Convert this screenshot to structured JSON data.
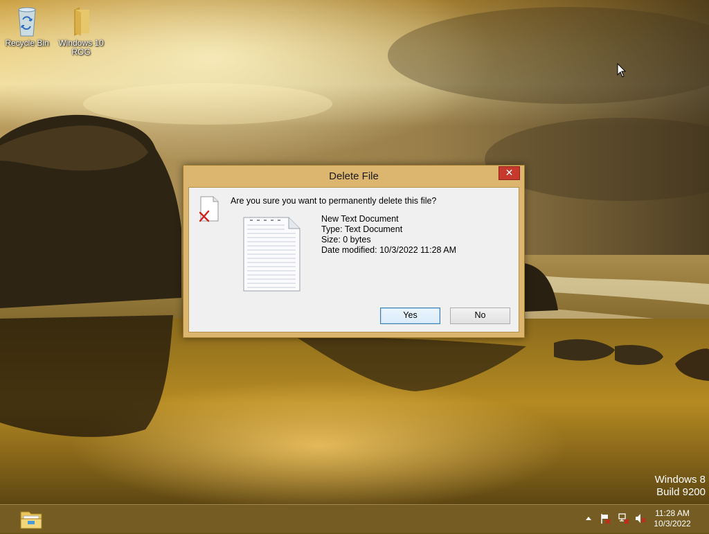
{
  "desktop": {
    "icons": [
      {
        "label": "Recycle Bin",
        "icon": "recycle-bin-icon"
      },
      {
        "label": "Windows 10 ROG",
        "icon": "folder-icon"
      }
    ],
    "watermark_line1": "Windows 8",
    "watermark_line2": "Build 9200"
  },
  "dialog": {
    "title": "Delete File",
    "close_label": "✕",
    "prompt": "Are you sure you want to permanently delete this file?",
    "file": {
      "name": "New Text Document",
      "type": "Type: Text Document",
      "size": "Size: 0 bytes",
      "modified": "Date modified: 10/3/2022 11:28 AM"
    },
    "yes_label": "Yes",
    "no_label": "No"
  },
  "taskbar": {
    "pinned": [
      {
        "icon": "file-explorer-icon"
      }
    ],
    "tray_icons": [
      "action-center-flag-icon",
      "network-disconnected-icon",
      "volume-muted-icon"
    ],
    "clock_time": "11:28 AM",
    "clock_date": "10/3/2022"
  },
  "colors": {
    "dialog_frame": "#dcb56e",
    "close_button": "#c7382d",
    "taskbar": "#786028"
  }
}
